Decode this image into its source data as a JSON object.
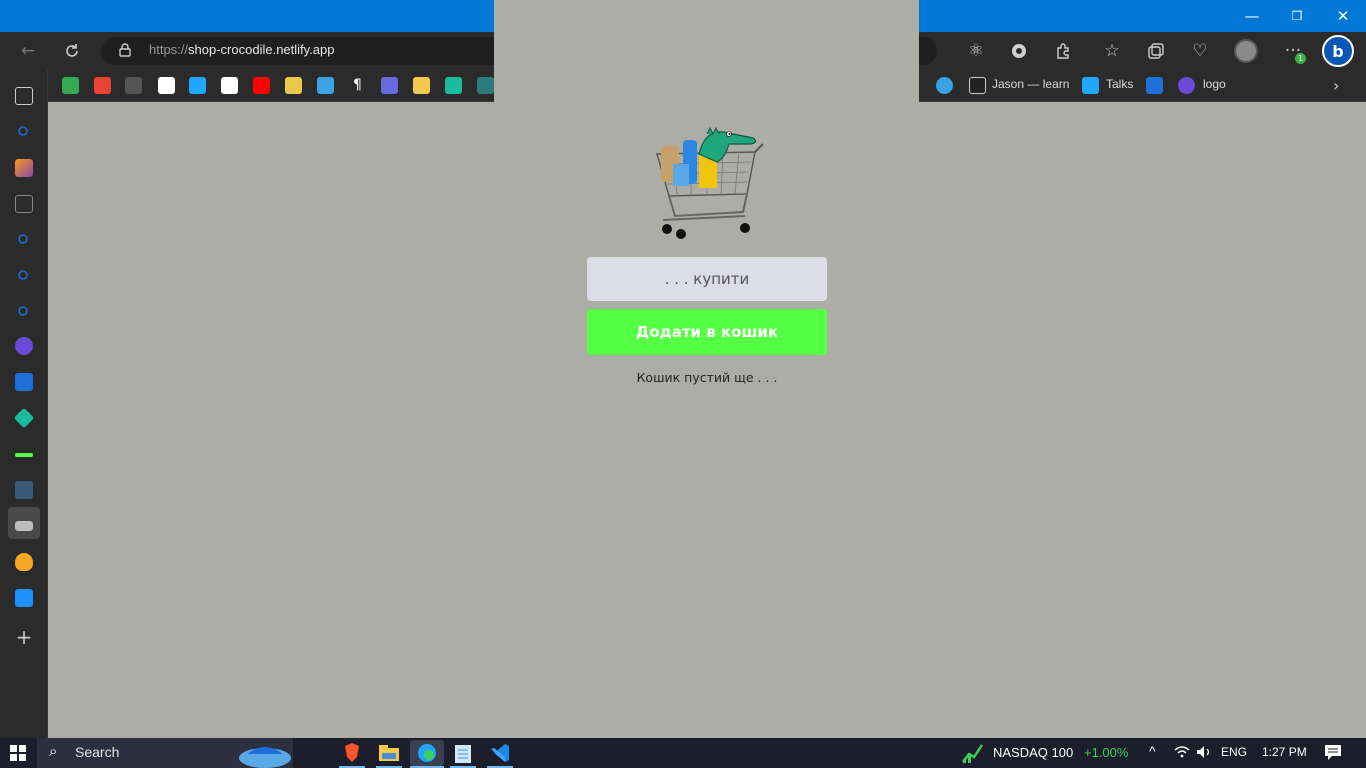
{
  "browser": {
    "address_bar": {
      "scheme": "https://",
      "host": "shop-crocodile.netlify.app"
    },
    "extension_badge": "1",
    "bing_label": "b",
    "favorites": [
      {
        "label": "Jason — learn"
      },
      {
        "label": "Talks"
      },
      {
        "label": "logo"
      }
    ],
    "window_controls": {
      "minimize": "—",
      "restore": "❐",
      "close": "✕"
    }
  },
  "app": {
    "input_placeholder": ". . . купити",
    "add_button_label": "Додати в кошик",
    "empty_message": "Кошик пустий ще . . ."
  },
  "taskbar": {
    "search_label": "Search",
    "ticker_name": "NASDAQ 100",
    "ticker_change": "+1.00%",
    "language": "ENG",
    "time": "1:27 PM"
  },
  "colors": {
    "titlebar": "#0078d4",
    "page_bg": "#acada6",
    "input_bg": "#dcdde6",
    "add_button_bg": "#55ff44",
    "ticker_up": "#3cd15b"
  },
  "icons": [
    "back-icon",
    "refresh-icon",
    "lock-icon",
    "react-icon",
    "extensions-icon",
    "favorites-icon",
    "collections-icon",
    "health-icon",
    "profile-icon",
    "more-icon",
    "bing-icon",
    "windows-start-icon",
    "search-icon",
    "brave-icon",
    "file-explorer-icon",
    "edge-icon",
    "notepad-icon",
    "vscode-icon",
    "chevron-up-icon",
    "wifi-icon",
    "volume-icon",
    "notification-icon",
    "shopping-cart-crocodile-logo"
  ]
}
